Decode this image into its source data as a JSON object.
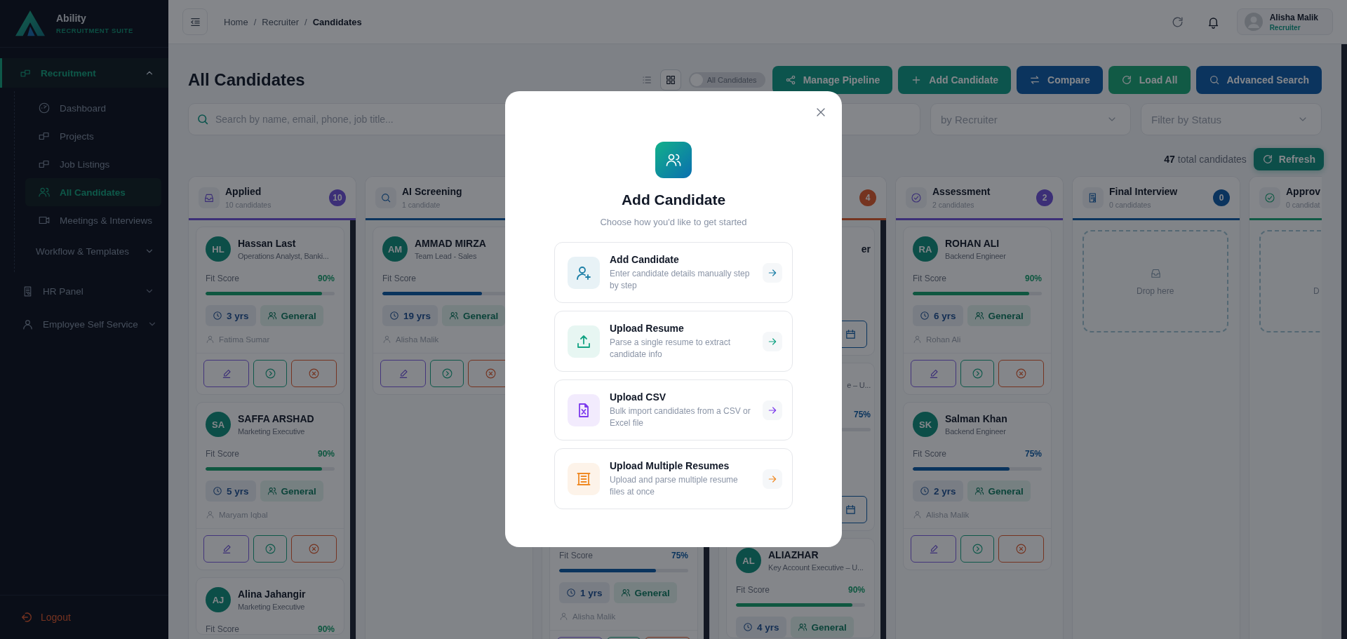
{
  "sidebar": {
    "brand": {
      "name": "Ability",
      "tagline": "RECRUITMENT SUITE"
    },
    "items": [
      {
        "label": "Recruitment",
        "selected": true,
        "expanded": true,
        "children": [
          {
            "label": "Dashboard",
            "selected": false
          },
          {
            "label": "Projects",
            "selected": false
          },
          {
            "label": "Job Listings",
            "selected": false
          },
          {
            "label": "All Candidates",
            "selected": true
          },
          {
            "label": "Meetings & Interviews",
            "selected": false
          },
          {
            "label": "Workflow & Templates",
            "selected": false,
            "expanded": false
          }
        ]
      },
      {
        "label": "HR Panel",
        "selected": false,
        "expanded": false
      },
      {
        "label": "Employee Self Service",
        "selected": false,
        "expanded": false
      }
    ],
    "logout": "Logout"
  },
  "topbar": {
    "breadcrumb": {
      "items": [
        "Home",
        "Recruiter",
        "Candidates"
      ],
      "separator": "/"
    },
    "user": {
      "name": "Alisha Malik",
      "role": "Recruiter"
    }
  },
  "page": {
    "title": "All Candidates",
    "view_modes": [
      {
        "selected": false
      },
      {
        "selected": true
      }
    ],
    "toggle": {
      "label": "All Candidates",
      "on": false
    },
    "actions": [
      {
        "label": "Manage Pipeline",
        "color": "#0c544d"
      },
      {
        "label": "Add Candidate",
        "color": "#0c544d"
      },
      {
        "label": "Compare",
        "color": "#0b345e"
      },
      {
        "label": "Load All",
        "color": "#115a45"
      },
      {
        "label": "Advanced Search",
        "color": "#0b345e"
      }
    ],
    "search": {
      "placeholder": "Search by name, email, phone, job title..."
    },
    "filters": [
      {
        "placeholder": "by Recruiter"
      },
      {
        "placeholder": "Filter by Status"
      }
    ],
    "total": "**47** total candidates",
    "refresh": "Refresh"
  },
  "columns": [
    {
      "title": "Applied",
      "subtitle": "10 candidates",
      "count": "10",
      "color": "#3c2f77",
      "scrollbar": true,
      "cards": [
        {
          "kind": "full",
          "initials": "HL",
          "name": "Hassan Last",
          "role": "Operations Analyst, Banki...",
          "score_label": "Fit Score",
          "score": "90%",
          "level": 0.9,
          "experience": "3 yrs",
          "tag": "General",
          "recruiter": "Fatima Sumar"
        },
        {
          "kind": "full",
          "initials": "SA",
          "name": "SAFFA ARSHAD",
          "role": "Marketing Executive",
          "score_label": "Fit Score",
          "score": "90%",
          "level": 0.9,
          "experience": "5 yrs",
          "tag": "General",
          "recruiter": "Maryam Iqbal"
        },
        {
          "kind": "full",
          "initials": "AJ",
          "name": "Alina Jahangir",
          "role": "Marketing Executive",
          "score_label": "Fit Score",
          "score": "90%"
        }
      ]
    },
    {
      "title": "AI Screening",
      "subtitle": "1 candidate",
      "color": "#0b345e",
      "scrollbar": false,
      "cards": [
        {
          "kind": "full",
          "initials": "AM",
          "name": "AMMAD MIRZA",
          "role": "Team Lead - Sales",
          "score_label": "Fit Score",
          "level": 0.77,
          "experience": "19 yrs",
          "tag": "General",
          "recruiter": "Alisha Malik"
        }
      ]
    },
    {
      "scrollbar": true,
      "cards": [
        {
          "kind": "tail",
          "score_label": "Fit Score",
          "score": "75%",
          "level": 0.75,
          "experience": "1 yrs",
          "tag": "General",
          "recruiter": "Alisha Malik"
        }
      ]
    },
    {
      "count": "4",
      "color": "#753420",
      "scrollbar": true,
      "cards": [
        {
          "kind": "partial",
          "name": "er"
        },
        {
          "kind": "partial",
          "role": "e – U...",
          "score": "75%"
        },
        {
          "kind": "full",
          "initials": "AL",
          "name": "ALIAZHAR",
          "role": "Key Account Executive – U...",
          "score_label": "Fit Score",
          "score": "90%",
          "level": 0.9,
          "experience": "4 yrs",
          "tag": "General"
        }
      ]
    },
    {
      "title": "Assessment",
      "subtitle": "2 candidates",
      "count": "2",
      "color": "#3c2f77",
      "scrollbar": false,
      "cards": [
        {
          "kind": "full",
          "initials": "RA",
          "name": "ROHAN ALI",
          "role": "Backend Engineer",
          "score_label": "Fit Score",
          "score": "90%",
          "level": 0.9,
          "experience": "6 yrs",
          "tag": "General",
          "recruiter": "Rohan Ali"
        },
        {
          "kind": "full",
          "initials": "SK",
          "name": "Salman Khan",
          "role": "Backend Engineer",
          "score_label": "Fit Score",
          "score": "75%",
          "level": 0.75,
          "experience": "2 yrs",
          "tag": "General",
          "recruiter": "Alisha Malik"
        }
      ]
    },
    {
      "title": "Final Interview",
      "subtitle": "0 candidates",
      "count": "0",
      "color": "#0b345e",
      "scrollbar": false,
      "drop": "Drop here"
    },
    {
      "title": "Approv",
      "subtitle": "0 candidat",
      "color": "#115a45",
      "scrollbar": false,
      "drop": "D"
    }
  ],
  "modal": {
    "title": "Add Candidate",
    "subtitle": "Choose how you'd like to get started",
    "options": [
      {
        "kind": "manual",
        "title": "Add Candidate",
        "description": "Enter candidate details manually step by step",
        "color": "#1b7ea6"
      },
      {
        "kind": "resume",
        "title": "Upload Resume",
        "description": "Parse a single resume to extract candidate info",
        "color": "#12a383"
      },
      {
        "kind": "csv",
        "title": "Upload CSV",
        "description": "Bulk import candidates from a CSV or Excel file",
        "color": "#7c3aed"
      },
      {
        "kind": "bulk",
        "title": "Upload Multiple Resumes",
        "description": "Upload and parse multiple resume files at once",
        "color": "#f08a24"
      }
    ]
  }
}
